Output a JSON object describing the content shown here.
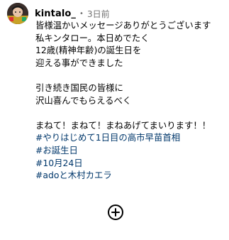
{
  "post": {
    "username": "kintalo_",
    "separator": "•",
    "timestamp": "3日前",
    "caption_lines": [
      "皆様温かいメッセージありがとうございます",
      "私キンタロー。本日めでたく",
      "12歳(精神年齢)の誕生日を",
      "迎える事ができました",
      "",
      "引き続き国民の皆様に",
      "沢山喜んでもらえるべく",
      "",
      "まねて！まねて！まねあげてまいります！！"
    ],
    "hashtags": [
      "#やりはじめて1日目の高市早苗首相",
      "#お誕生日",
      "#10月24日",
      "#adoと木村カエラ"
    ]
  },
  "icons": {
    "avatar": "profile-photo",
    "add": "plus-circle-icon"
  },
  "colors": {
    "text": "#000000",
    "secondary": "#737373",
    "hashtag": "#00376b"
  }
}
